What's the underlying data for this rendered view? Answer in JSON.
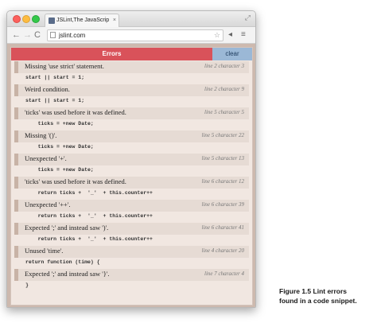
{
  "browser": {
    "tab_title": "JSLint,The JavaScript Code Q",
    "tab_close": "×",
    "url": "jslint.com",
    "back_glyph": "←",
    "forward_glyph": "→",
    "reload_glyph": "C",
    "star_glyph": "☆",
    "menu_glyph": "≡",
    "ext_glyph": "◂",
    "resize_glyph": "⤢"
  },
  "header": {
    "errors_label": "Errors",
    "clear_label": "clear"
  },
  "rows": [
    {
      "type": "msg",
      "text": "Missing 'use strict' statement.",
      "loc": "line 2 character 3"
    },
    {
      "type": "code",
      "text": "start || start = 1;"
    },
    {
      "type": "msg",
      "text": "Weird condition.",
      "loc": "line 2 character 9"
    },
    {
      "type": "code",
      "text": "start || start = 1;"
    },
    {
      "type": "msg",
      "text": "'ticks' was used before it was defined.",
      "loc": "line 5 character 5"
    },
    {
      "type": "code",
      "text": "    ticks = +new Date;"
    },
    {
      "type": "msg",
      "text": "Missing '()'.",
      "loc": "line 5 character 22"
    },
    {
      "type": "code",
      "text": "    ticks = +new Date;"
    },
    {
      "type": "msg",
      "text": "Unexpected '+'.",
      "loc": "line 5 character 13"
    },
    {
      "type": "code",
      "text": "    ticks = +new Date;"
    },
    {
      "type": "msg",
      "text": "'ticks' was used before it was defined.",
      "loc": "line 6 character 12"
    },
    {
      "type": "code",
      "text": "    return ticks +  '_'  + this.counter++"
    },
    {
      "type": "msg",
      "text": "Unexpected '++'.",
      "loc": "line 6 character 39"
    },
    {
      "type": "code",
      "text": "    return ticks +  '_'  + this.counter++"
    },
    {
      "type": "msg",
      "text": "Expected ';' and instead saw ')'.",
      "loc": "line 6 character 41"
    },
    {
      "type": "code",
      "text": "    return ticks +  '_'  + this.counter++"
    },
    {
      "type": "msg",
      "text": "Unused 'time'.",
      "loc": "line 4 character 20"
    },
    {
      "type": "code",
      "text": "return function (time) {"
    },
    {
      "type": "msg",
      "text": "Expected ';' and instead saw '}'.",
      "loc": "line 7 character 4"
    },
    {
      "type": "code",
      "text": "}"
    }
  ],
  "caption": {
    "line1": "Figure 1.5   Lint errors",
    "line2": "found in a code snippet."
  }
}
